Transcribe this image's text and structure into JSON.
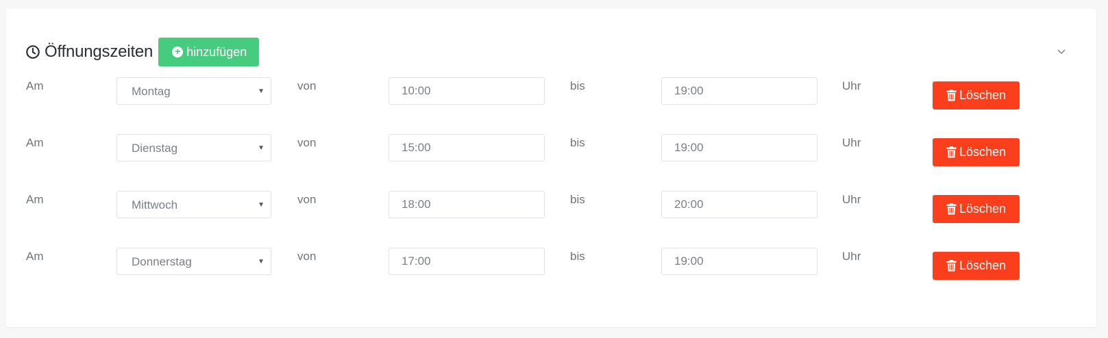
{
  "section": {
    "title": "Öffnungszeiten",
    "add_label": "hinzufügen",
    "icons": {
      "title": "clock-icon",
      "add": "plus-circle-icon",
      "collapse": "chevron-down-icon",
      "delete": "trash-icon"
    },
    "colors": {
      "add_button": "#45cc7e",
      "delete_button": "#fb3f1c"
    }
  },
  "rows": [
    {
      "am": "Am",
      "day": "Montag",
      "von": "von",
      "from": "10:00",
      "bis": "bis",
      "to": "19:00",
      "uhr": "Uhr",
      "delete_label": "Löschen"
    },
    {
      "am": "Am",
      "day": "Dienstag",
      "von": "von",
      "from": "15:00",
      "bis": "bis",
      "to": "19:00",
      "uhr": "Uhr",
      "delete_label": "Löschen"
    },
    {
      "am": "Am",
      "day": "Mittwoch",
      "von": "von",
      "from": "18:00",
      "bis": "bis",
      "to": "20:00",
      "uhr": "Uhr",
      "delete_label": "Löschen"
    },
    {
      "am": "Am",
      "day": "Donnerstag",
      "von": "von",
      "from": "17:00",
      "bis": "bis",
      "to": "19:00",
      "uhr": "Uhr",
      "delete_label": "Löschen"
    }
  ]
}
